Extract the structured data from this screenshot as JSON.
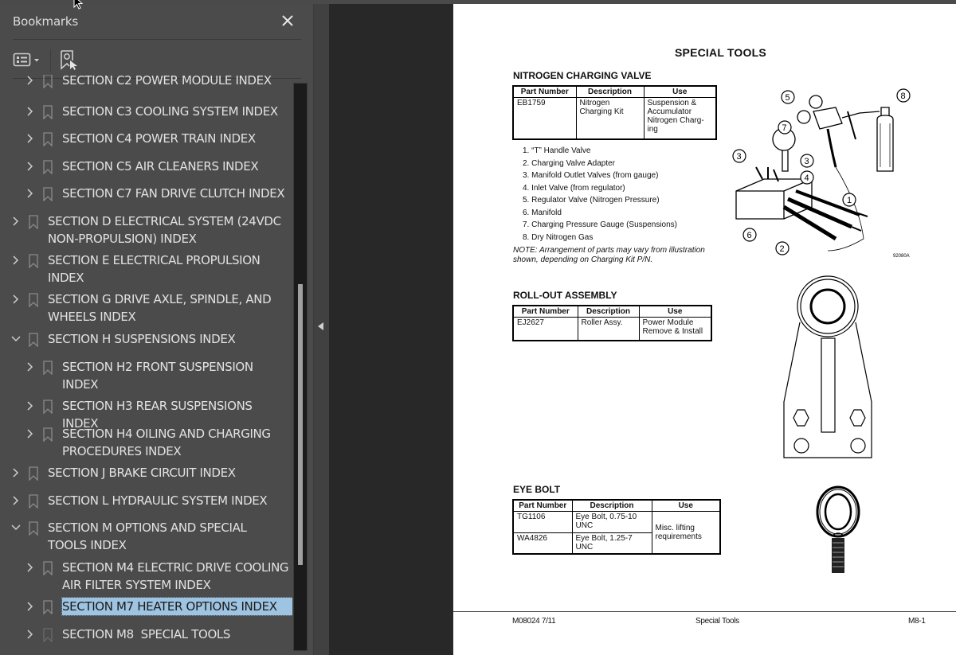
{
  "bookmarks_panel": {
    "title": "Bookmarks",
    "close_icon": "close-icon",
    "toolbar": {
      "options_icon": "list-options-icon",
      "find_icon": "find-current-bookmark-icon"
    },
    "items": [
      {
        "label": "SECTION C2 POWER MODULE INDEX",
        "level": 2,
        "expanded": false
      },
      {
        "label": "SECTION C3 COOLING SYSTEM INDEX",
        "level": 2,
        "expanded": false
      },
      {
        "label": "SECTION C4 POWER TRAIN INDEX",
        "level": 2,
        "expanded": false
      },
      {
        "label": "SECTION C5 AIR CLEANERS INDEX",
        "level": 2,
        "expanded": false
      },
      {
        "label": "SECTION C7 FAN DRIVE CLUTCH INDEX",
        "level": 2,
        "expanded": false
      },
      {
        "label": "SECTION D ELECTRICAL SYSTEM (24VDC NON-PROPULSION) INDEX",
        "level": 1,
        "expanded": false
      },
      {
        "label": "SECTION E ELECTRICAL PROPULSION INDEX",
        "level": 1,
        "expanded": false
      },
      {
        "label": "SECTION G DRIVE AXLE, SPINDLE, AND WHEELS INDEX",
        "level": 1,
        "expanded": false
      },
      {
        "label": "SECTION H SUSPENSIONS INDEX",
        "level": 1,
        "expanded": true
      },
      {
        "label": "SECTION H2 FRONT SUSPENSION INDEX",
        "level": 2,
        "expanded": false
      },
      {
        "label": "SECTION H3 REAR SUSPENSIONS INDEX",
        "level": 2,
        "expanded": false
      },
      {
        "label": "SECTION H4 OILING AND CHARGING PROCEDURES INDEX",
        "level": 2,
        "expanded": false
      },
      {
        "label": "SECTION J BRAKE CIRCUIT INDEX",
        "level": 1,
        "expanded": false
      },
      {
        "label": "SECTION L HYDRAULIC SYSTEM INDEX",
        "level": 1,
        "expanded": false
      },
      {
        "label": "SECTION M OPTIONS AND SPECIAL TOOLS INDEX",
        "level": 1,
        "expanded": true
      },
      {
        "label": "SECTION M4 ELECTRIC DRIVE COOLING AIR FILTER SYSTEM INDEX",
        "level": 2,
        "expanded": false
      },
      {
        "label": "SECTION M7 HEATER OPTIONS INDEX",
        "level": 2,
        "expanded": false,
        "selected": true
      },
      {
        "label": "SECTION M8  SPECIAL TOOLS",
        "level": 2,
        "expanded": false
      }
    ],
    "colors": {
      "selected_bg": "#9ec4e2",
      "panel_bg": "#4b4b4b"
    }
  },
  "document": {
    "page_title": "SPECIAL TOOLS",
    "nitrogen": {
      "title": "NITROGEN CHARGING VALVE",
      "headers": [
        "Part Number",
        "Description",
        "Use"
      ],
      "rows": [
        [
          "EB1759",
          "Nitrogen Charging Kit",
          "Suspension & Accumulator Nitrogen Charg-ing"
        ]
      ],
      "legend": [
        "1. “T” Handle Valve",
        "2. Charging Valve Adapter",
        "3. Manifold Outlet Valves (from gauge)",
        "4. Inlet Valve (from regulator)",
        "5. Regulator Valve (Nitrogen Pressure)",
        "6. Manifold",
        "7. Charging Pressure Gauge (Suspensions)",
        "8. Dry Nitrogen Gas"
      ],
      "note": "NOTE: Arrangement of parts may vary from illustration shown, depending on Charging Kit P/N.",
      "figure_id": "92080A",
      "callouts": [
        "1",
        "2",
        "3",
        "3",
        "4",
        "5",
        "6",
        "7",
        "8"
      ]
    },
    "rollout": {
      "title": "ROLL-OUT ASSEMBLY",
      "headers": [
        "Part Number",
        "Description",
        "Use"
      ],
      "rows": [
        [
          "EJ2627",
          "Roller Assy.",
          "Power Module Remove & Install"
        ]
      ]
    },
    "eyebolt": {
      "title": "EYE BOLT",
      "headers": [
        "Part Number",
        "Description",
        "Use"
      ],
      "rows": [
        [
          "TG1106",
          "Eye Bolt, 0.75-10 UNC",
          "Misc. lifting requirements"
        ],
        [
          "WA4826",
          "Eye Bolt, 1.25-7 UNC",
          ""
        ]
      ]
    },
    "footer": {
      "left": "M08024  7/11",
      "center": "Special Tools",
      "right": "M8-1"
    }
  }
}
